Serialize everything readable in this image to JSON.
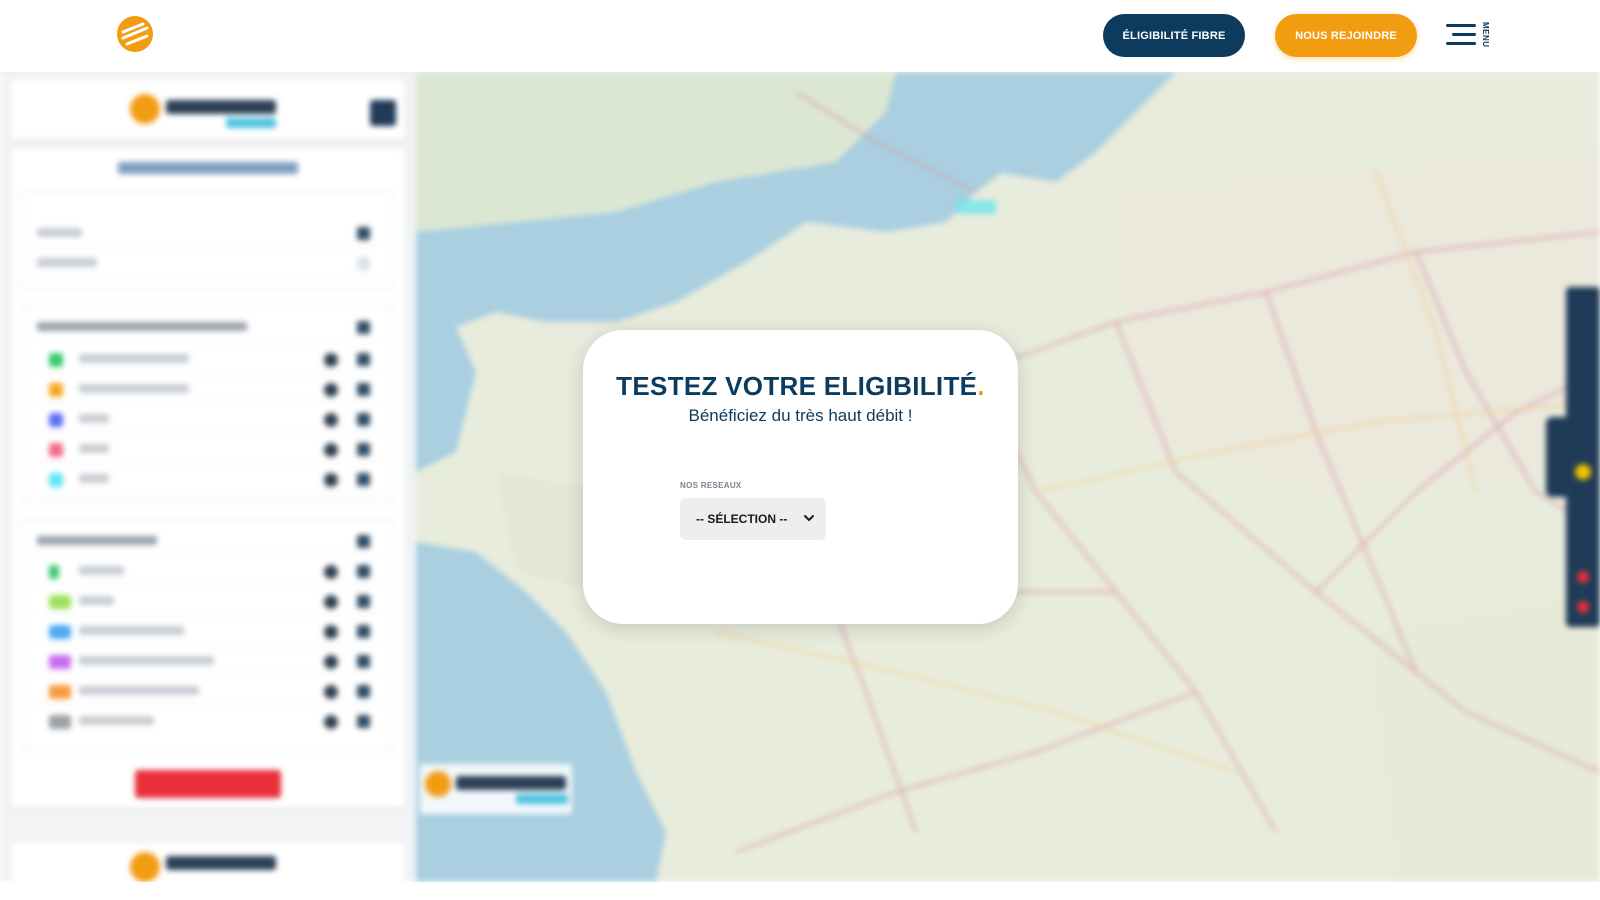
{
  "header": {
    "logo_icon": "sun-stripes-logo",
    "eligibility_button": "ÉLIGIBILITÉ FIBRE",
    "join_button": "NOUS REJOINDRE",
    "menu_label": "MENU",
    "colors": {
      "navy": "#0d3b5e",
      "orange": "#f29c12"
    }
  },
  "modal": {
    "title": "TESTEZ VOTRE ELIGIBILITÉ",
    "title_accent": ".",
    "subtitle": "Bénéficiez du très haut débit !",
    "network_label": "NOS RESEAUX",
    "network_select_value": "-- SÉLECTION --"
  }
}
